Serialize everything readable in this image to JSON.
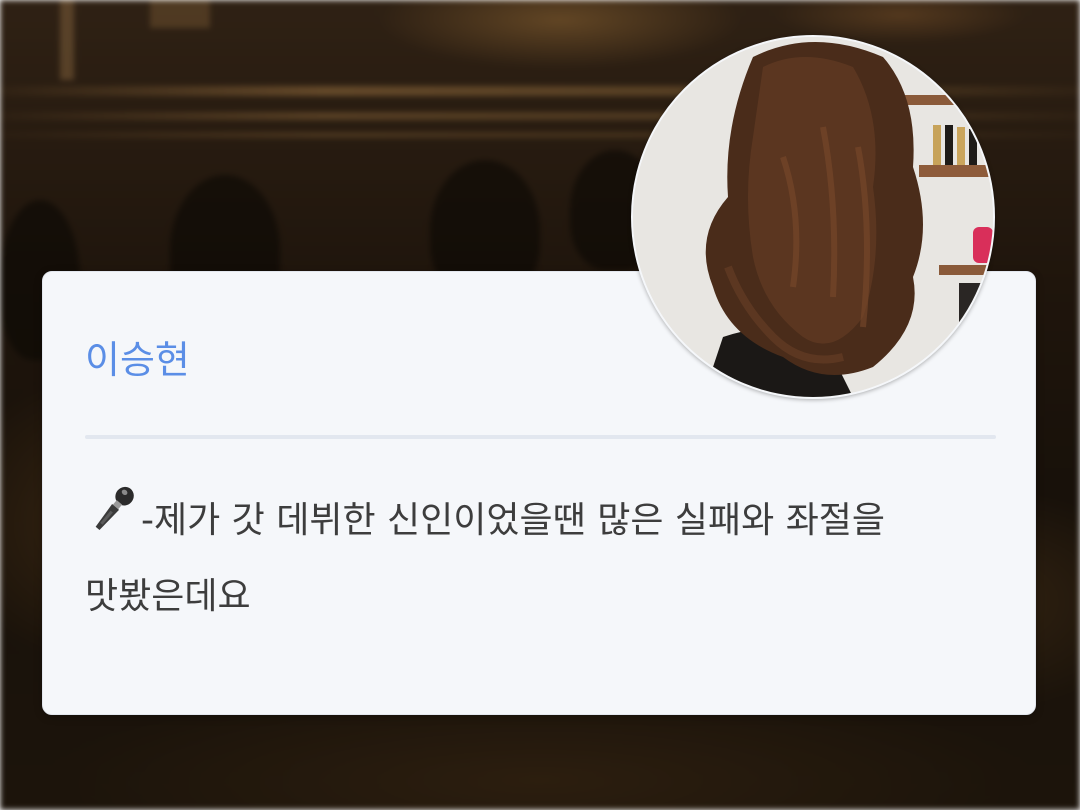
{
  "profile": {
    "name": "이승현",
    "avatar_alt": "long-hair-photo"
  },
  "post": {
    "icon": "microphone-icon",
    "text": "-제가 갓 데뷔한 신인이었을땐 많은 실패와 좌절을 맛봤은데요"
  },
  "colors": {
    "name": "#5b8ee6",
    "card_background": "#f5f7fa",
    "text": "#3d3d3d"
  }
}
